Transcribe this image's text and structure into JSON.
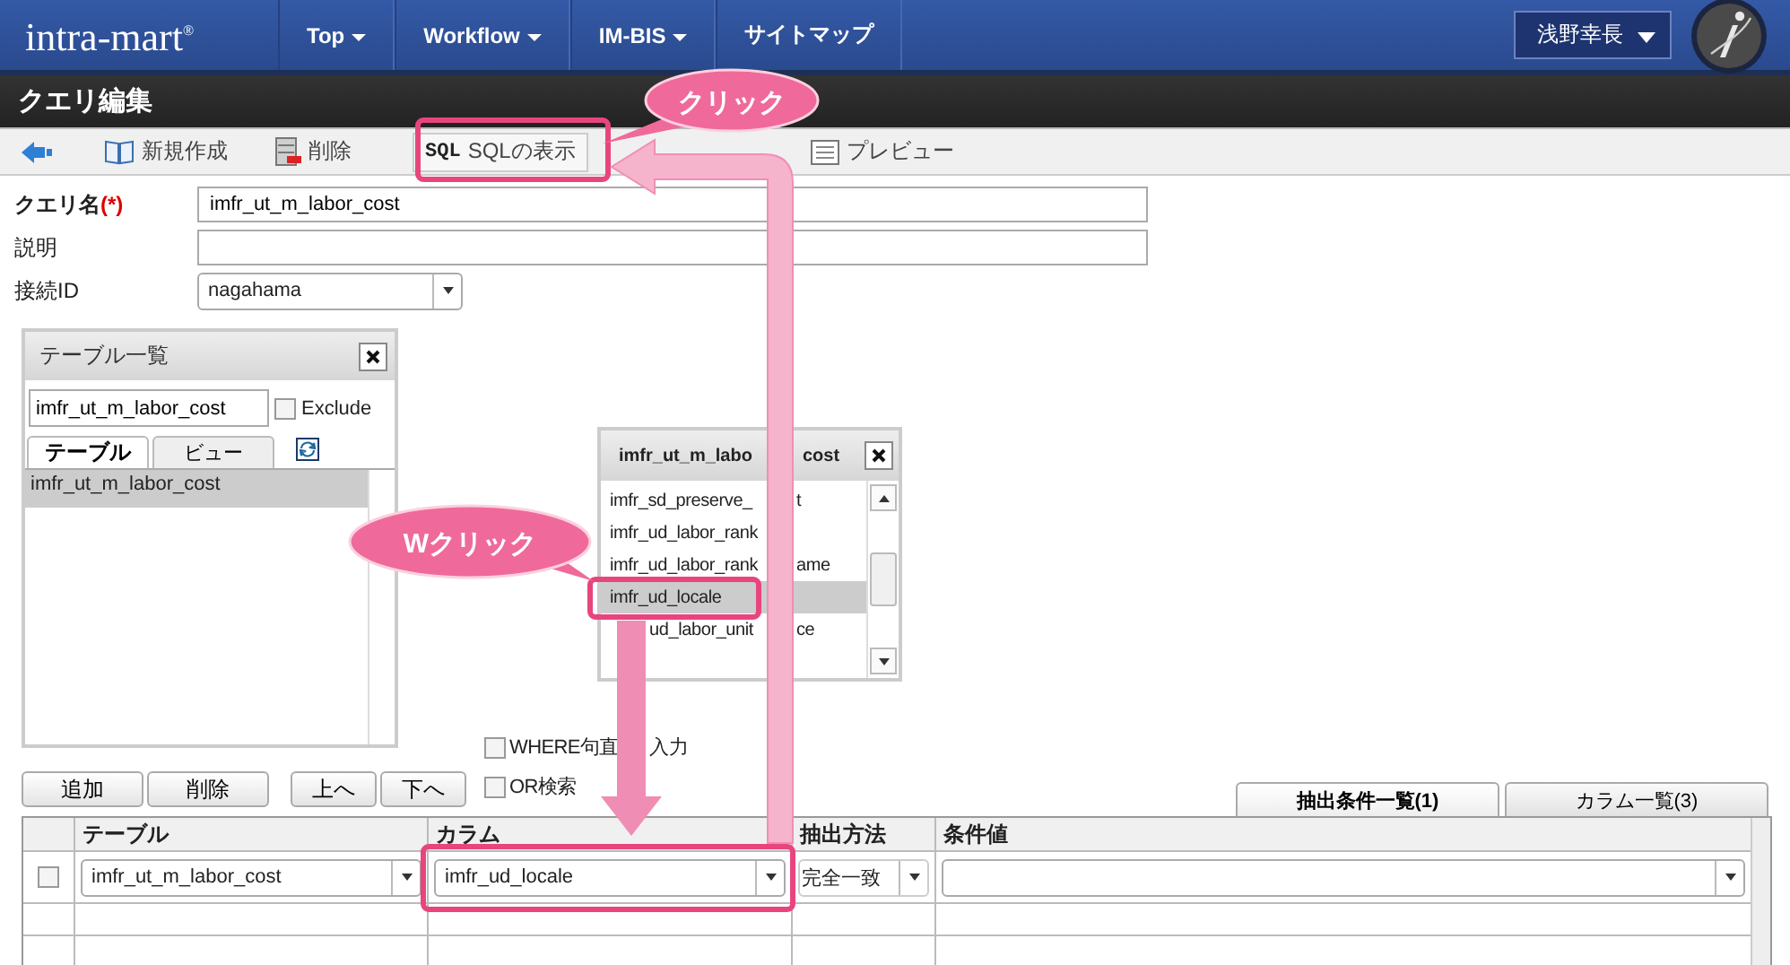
{
  "header": {
    "logo": "intra-mart$^{®}$",
    "nav": [
      {
        "label": "Top",
        "has_menu": true
      },
      {
        "label": "Workflow",
        "has_menu": true
      },
      {
        "label": "IM-BIS",
        "has_menu": true
      },
      {
        "label": "サイトマップ",
        "has_menu": false
      }
    ],
    "user": "浅野幸長"
  },
  "page_title": "クエリ編集",
  "toolbar": [
    {
      "kind": "back"
    },
    {
      "kind": "new",
      "label": "新規作成"
    },
    {
      "kind": "delete",
      "label": "削除"
    },
    {
      "kind": "sql",
      "icon_text": "SQL",
      "label": "SQLの表示"
    },
    {
      "kind": "preview",
      "label": "プレビュー"
    }
  ],
  "form": [
    {
      "label": "クエリ名",
      "required_mark": "(*)",
      "kind": "text",
      "value": "imfr_ut_m_labor_cost"
    },
    {
      "label": "説明",
      "kind": "text"
    },
    {
      "label": "接続ID",
      "kind": "select",
      "value": "nagahama"
    }
  ],
  "table_list": {
    "title": "テーブル一覧",
    "filter": "imfr_ut_m_labor_cost",
    "exclude": {
      "label": "Exclude",
      "checked": false
    },
    "tabs": [
      {
        "label": "テーブル",
        "selected": true
      },
      {
        "label": "ビュー",
        "selected": false
      }
    ],
    "items": [
      {
        "label": "imfr_ut_m_labor_cost",
        "selected": true
      }
    ]
  },
  "column_window": {
    "title": "imfr_ut_m_labo",
    "title_tail": "cost",
    "items": [
      {
        "label": "imfr_sd_preserve_",
        "tail": "t",
        "selected": false
      },
      {
        "label": "imfr_ud_labor_rank",
        "selected": false
      },
      {
        "label": "imfr_ud_labor_rank",
        "tail": "ame",
        "selected": false
      },
      {
        "label": "imfr_ud_locale",
        "selected": true
      },
      {
        "label": "ud_labor_unit",
        "tail": "ce",
        "selected": false,
        "start_covered": true
      }
    ]
  },
  "options": [
    {
      "label": "WHERE句直",
      "tail": "入力",
      "checked": false
    },
    {
      "label": "OR検索",
      "checked": false
    }
  ],
  "edit_buttons": [
    "追加",
    "削除"
  ],
  "move_buttons": [
    "上へ",
    "下へ"
  ],
  "result_tabs": [
    {
      "label": "抽出条件一覧(1)",
      "selected": true
    },
    {
      "label": "カラム一覧(3)",
      "selected": false
    }
  ],
  "grid": {
    "columns": [
      "テーブル",
      "カラム",
      "抽出方法",
      "条件値"
    ],
    "rows": [
      {
        "checked": false,
        "table": "imfr_ut_m_labor_cost",
        "column": "imfr_ud_locale",
        "method": "完全一致"
      }
    ]
  },
  "callouts": [
    {
      "text": "クリック"
    },
    {
      "text": "Wクリック"
    }
  ]
}
